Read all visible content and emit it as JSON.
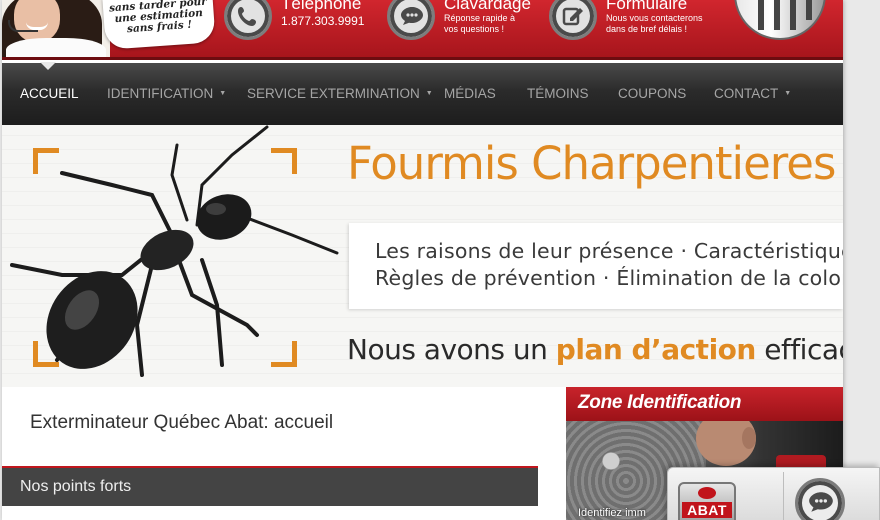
{
  "header": {
    "bubble_lines": [
      "sans tarder pour",
      "une estimation",
      "sans frais !"
    ],
    "phone": {
      "title": "Téléphone",
      "number": "1.877.303.9991",
      "icon": "phone-icon"
    },
    "chat": {
      "title": "Clavardage",
      "sub_lines": [
        "Réponse rapide à",
        "vos questions !"
      ],
      "icon": "chat-bubble-icon"
    },
    "form": {
      "title": "Formulaire",
      "sub_lines": [
        "Nous vous contacterons",
        "dans de bref délais !"
      ],
      "icon": "edit-form-icon"
    }
  },
  "nav": {
    "items": [
      {
        "label": "ACCUEIL",
        "active": true,
        "dropdown": false
      },
      {
        "label": "IDENTIFICATION",
        "dropdown": true
      },
      {
        "label": "SERVICE EXTERMINATION",
        "dropdown": true
      },
      {
        "label": "MÉDIAS",
        "dropdown": false
      },
      {
        "label": "TÉMOINS",
        "dropdown": false
      },
      {
        "label": "COUPONS",
        "dropdown": false
      },
      {
        "label": "CONTACT",
        "dropdown": true
      }
    ],
    "caret": "▼"
  },
  "banner": {
    "title": "Fourmis Charpentieres",
    "line1": "Les raisons de leur présence · Caractéristiques",
    "line2": "Règles de prévention · Élimination de la colonie",
    "tagline_pre": "Nous avons un ",
    "tagline_highlight": "plan d’action",
    "tagline_post": " efficace",
    "accent_color": "#e08a22"
  },
  "main": {
    "page_title": "Exterminateur Québec Abat: accueil",
    "section_title": "Nos points forts"
  },
  "sidebar": {
    "zone_title": "Zone Identification",
    "zone_caption": "Identifiez imm"
  },
  "chat_widget": {
    "logo_text": "ABAT",
    "icon": "chat-bubble-icon"
  },
  "colors": {
    "brand_red": "#c8232b",
    "nav_dark": "#2b2b2b",
    "nav_active_text": "#ffffff",
    "nav_text": "#a5a5a5"
  }
}
